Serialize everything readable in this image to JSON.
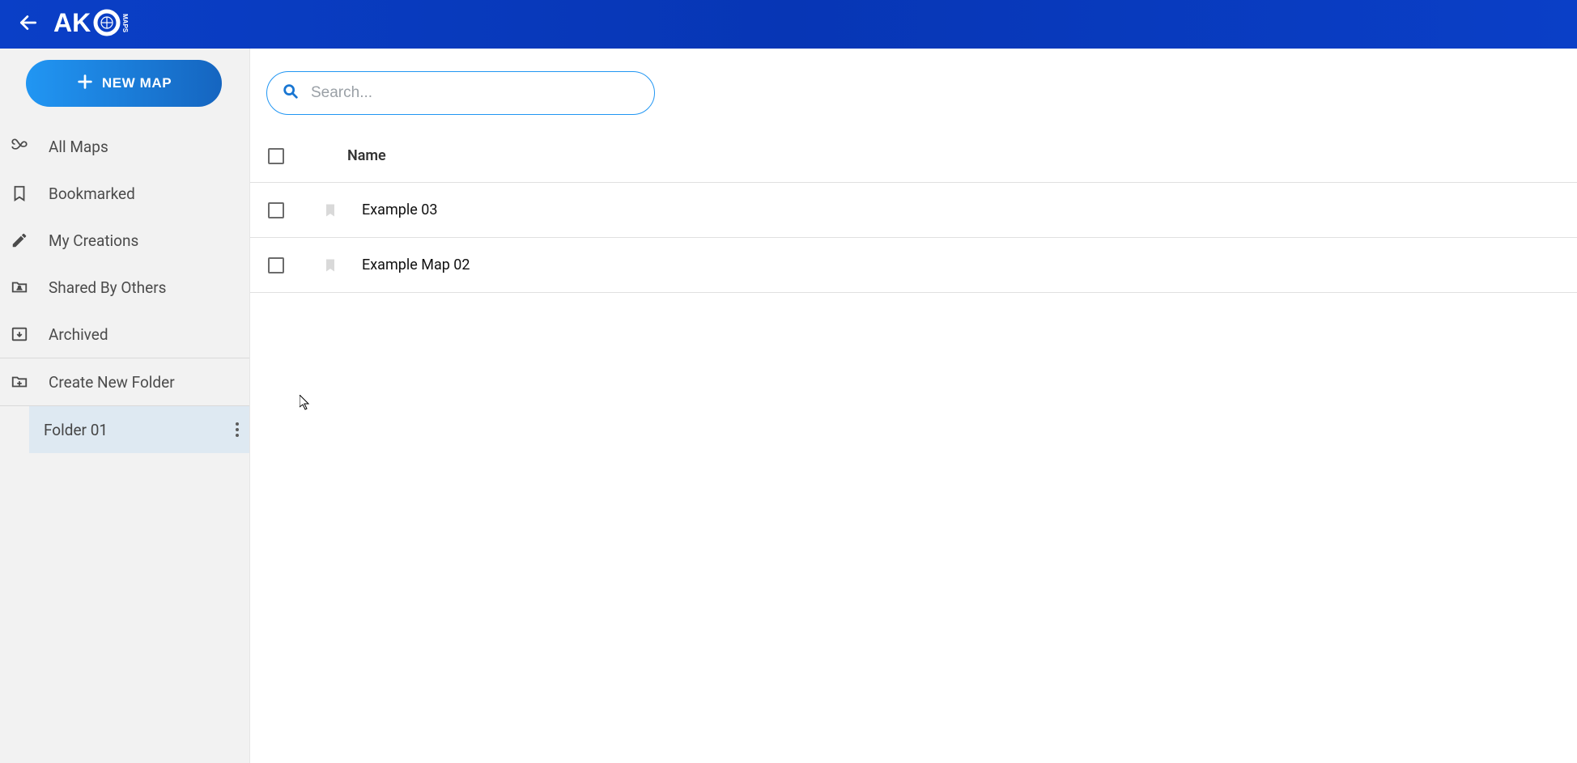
{
  "header": {
    "logo_text": "AKO MAPS"
  },
  "sidebar": {
    "new_map_label": "NEW MAP",
    "items": [
      {
        "label": "All Maps"
      },
      {
        "label": "Bookmarked"
      },
      {
        "label": "My Creations"
      },
      {
        "label": "Shared By Others"
      },
      {
        "label": "Archived"
      }
    ],
    "create_folder_label": "Create New Folder",
    "folders": [
      {
        "label": "Folder 01"
      }
    ]
  },
  "search": {
    "placeholder": "Search..."
  },
  "table": {
    "header_name": "Name",
    "rows": [
      {
        "name": "Example 03"
      },
      {
        "name": "Example Map 02"
      }
    ]
  }
}
